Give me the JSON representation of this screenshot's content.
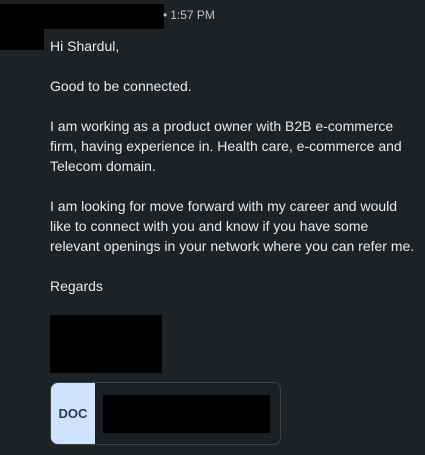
{
  "message": {
    "time": "1:57 PM",
    "greeting": "Hi Shardul,",
    "line_connected": "Good to be connected.",
    "para1": "I am working as a product owner with B2B e-commerce firm, having experience in. Health care, e-commerce and Telecom domain.",
    "para2": "I am looking for move forward with my career and would like to connect with you and know if you have some relevant openings in your network where you can refer me.",
    "closing": "Regards"
  },
  "attachment": {
    "type_label": "DOC"
  }
}
